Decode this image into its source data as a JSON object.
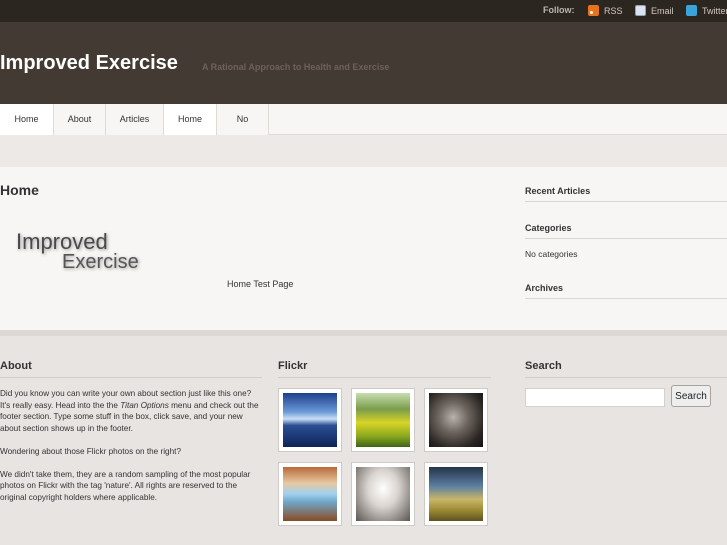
{
  "topbar": {
    "follow_label": "Follow:",
    "links": [
      {
        "label": "RSS",
        "icon": "rss-icon"
      },
      {
        "label": "Email",
        "icon": "email-icon"
      },
      {
        "label": "Twitter",
        "icon": "twitter-icon"
      }
    ]
  },
  "header": {
    "site_title": "Improved Exercise",
    "tagline": "A Rational Approach to Health and Exercise"
  },
  "nav": {
    "items": [
      {
        "label": "Home"
      },
      {
        "label": "About"
      },
      {
        "label": "Articles"
      },
      {
        "label": "Home"
      },
      {
        "label": "No categories"
      }
    ]
  },
  "main": {
    "page_title": "Home",
    "logo_line1": "Improved",
    "logo_line2": "Exercise",
    "body_text": "Home Test Page"
  },
  "sidebar": {
    "recent_articles_heading": "Recent Articles",
    "categories_heading": "Categories",
    "categories_text": "No categories",
    "archives_heading": "Archives"
  },
  "footer": {
    "about": {
      "heading": "About",
      "para1_a": "Did you know you can write your own about section just like this one? It's really easy. Head into the the ",
      "para1_em": "Titan Options",
      "para1_b": " menu and check out the footer section. Type some stuff in the box, click save, and your new about section shows up in the footer.",
      "para2": "Wondering about those Flickr photos on the right?",
      "para3": "We didn't take them, they are a random sampling of the most popular photos on Flickr with the tag 'nature'. All rights are reserved to the original copyright holders where applicable."
    },
    "flickr": {
      "heading": "Flickr",
      "photos": [
        {
          "name": "flickr-photo-lake"
        },
        {
          "name": "flickr-photo-field"
        },
        {
          "name": "flickr-photo-portrait"
        },
        {
          "name": "flickr-photo-arches"
        },
        {
          "name": "flickr-photo-tree"
        },
        {
          "name": "flickr-photo-hills"
        }
      ]
    },
    "search": {
      "heading": "Search",
      "input_value": "",
      "button_label": "Search"
    }
  }
}
